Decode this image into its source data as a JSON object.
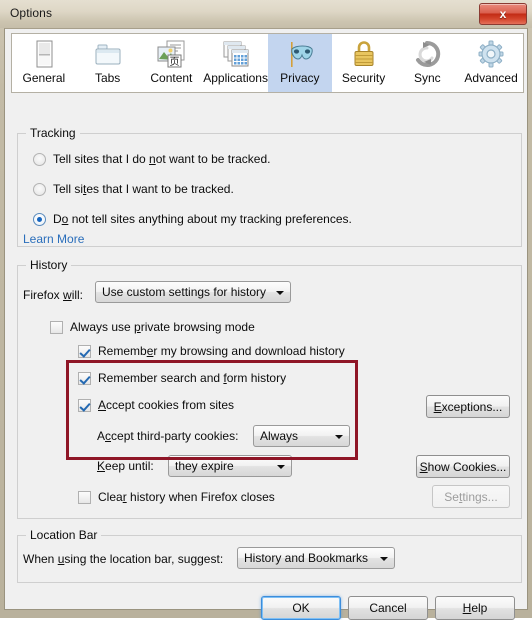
{
  "window": {
    "title": "Options",
    "close_label": "x"
  },
  "tabs": [
    {
      "label": "General",
      "icon": "document-page-icon",
      "selected": false
    },
    {
      "label": "Tabs",
      "icon": "folder-tabs-icon",
      "selected": false
    },
    {
      "label": "Content",
      "icon": "image-text-icon",
      "selected": false
    },
    {
      "label": "Applications",
      "icon": "windows-stack-icon",
      "selected": false
    },
    {
      "label": "Privacy",
      "icon": "mask-icon",
      "selected": true
    },
    {
      "label": "Security",
      "icon": "padlock-icon",
      "selected": false
    },
    {
      "label": "Sync",
      "icon": "sync-arrows-icon",
      "selected": false
    },
    {
      "label": "Advanced",
      "icon": "gear-icon",
      "selected": false
    }
  ],
  "tracking": {
    "legend": "Tracking",
    "options": [
      {
        "label_pre": "Tell sites that I do ",
        "accel": "n",
        "label_post": "ot want to be tracked.",
        "selected": false
      },
      {
        "label_pre": "Tell si",
        "accel": "t",
        "label_post": "es that I want to be tracked.",
        "selected": false
      },
      {
        "label_pre": "D",
        "accel": "o",
        "label_post": " not tell sites anything about my tracking preferences.",
        "selected": true
      }
    ],
    "learn_more": "Learn More"
  },
  "history": {
    "legend": "History",
    "firefox_will_label_pre": "Firefox ",
    "firefox_will_accel": "w",
    "firefox_will_label_post": "ill:",
    "firefox_will_value": "Use custom settings for history",
    "private_browsing": {
      "label_pre": "Always use ",
      "accel": "p",
      "label_post": "rivate browsing mode",
      "checked": false
    },
    "remember_browsing": {
      "label_pre": "Rememb",
      "accel": "e",
      "label_post": "r my browsing and download history",
      "checked": true
    },
    "remember_forms": {
      "label_pre": "Remember search and ",
      "accel": "f",
      "label_post": "orm history",
      "checked": true
    },
    "accept_cookies": {
      "label_pre": "",
      "accel": "A",
      "label_post": "ccept cookies from sites",
      "checked": true
    },
    "third_party_label_pre": "A",
    "third_party_accel": "c",
    "third_party_label_post": "cept third-party cookies:",
    "third_party_value": "Always",
    "keep_until_label_pre": "",
    "keep_until_accel": "K",
    "keep_until_label_post": "eep until:",
    "keep_until_value": "they expire",
    "clear_history": {
      "label_pre": "Clea",
      "accel": "r",
      "label_post": " history when Firefox closes",
      "checked": false
    },
    "exceptions_button": "Exceptions...",
    "exceptions_accel": "E",
    "show_cookies_button": "Show Cookies...",
    "show_cookies_accel": "S",
    "settings_button": "Settings...",
    "settings_accel": "t",
    "settings_disabled": true
  },
  "location_bar": {
    "legend": "Location Bar",
    "label_pre": "When ",
    "accel": "u",
    "label_post": "sing the location bar, suggest:",
    "value": "History and Bookmarks"
  },
  "dialog_buttons": {
    "ok": "OK",
    "cancel": "Cancel",
    "help_pre": "",
    "help_accel": "H",
    "help_post": "elp"
  },
  "colors": {
    "selected_tab_bg": "#c3d5ef",
    "highlight_border": "#8f1627",
    "link": "#2a6ebb",
    "dialog_bg": "#f0f0f0",
    "titlebar": "#ded7c6",
    "close_red": "#c22b15",
    "check_blue": "#2469b2"
  }
}
